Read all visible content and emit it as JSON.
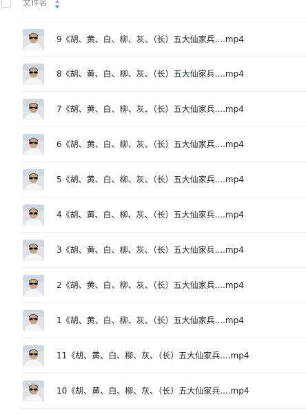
{
  "header": {
    "column_title": "文件名",
    "sort_icon": "sort-arrows-icon"
  },
  "files": [
    {
      "name": "9《胡、黄、白、柳、灰、（长）五大仙家兵....mp4"
    },
    {
      "name": "8《胡、黄、白、柳、灰、（长）五大仙家兵....mp4"
    },
    {
      "name": "7《胡、黄、白、柳、灰、（长）五大仙家兵....mp4"
    },
    {
      "name": "6《胡、黄、白、柳、灰、（长）五大仙家兵....mp4"
    },
    {
      "name": "5《胡、黄、白、柳、灰、（长）五大仙家兵....mp4"
    },
    {
      "name": "4《胡、黄、白、柳、灰、（长）五大仙家兵....mp4"
    },
    {
      "name": "3《胡、黄、白、柳、灰、（长）五大仙家兵....mp4"
    },
    {
      "name": "2《胡、黄、白、柳、灰、（长）五大仙家兵....mp4"
    },
    {
      "name": "1《胡、黄、白、柳、灰、（长）五大仙家兵....mp4"
    },
    {
      "name": "11《胡、黄、白、柳、灰、（长）五大仙家兵....mp4"
    },
    {
      "name": "10《胡、黄、白、柳、灰、（长）五大仙家兵....mp4"
    }
  ]
}
